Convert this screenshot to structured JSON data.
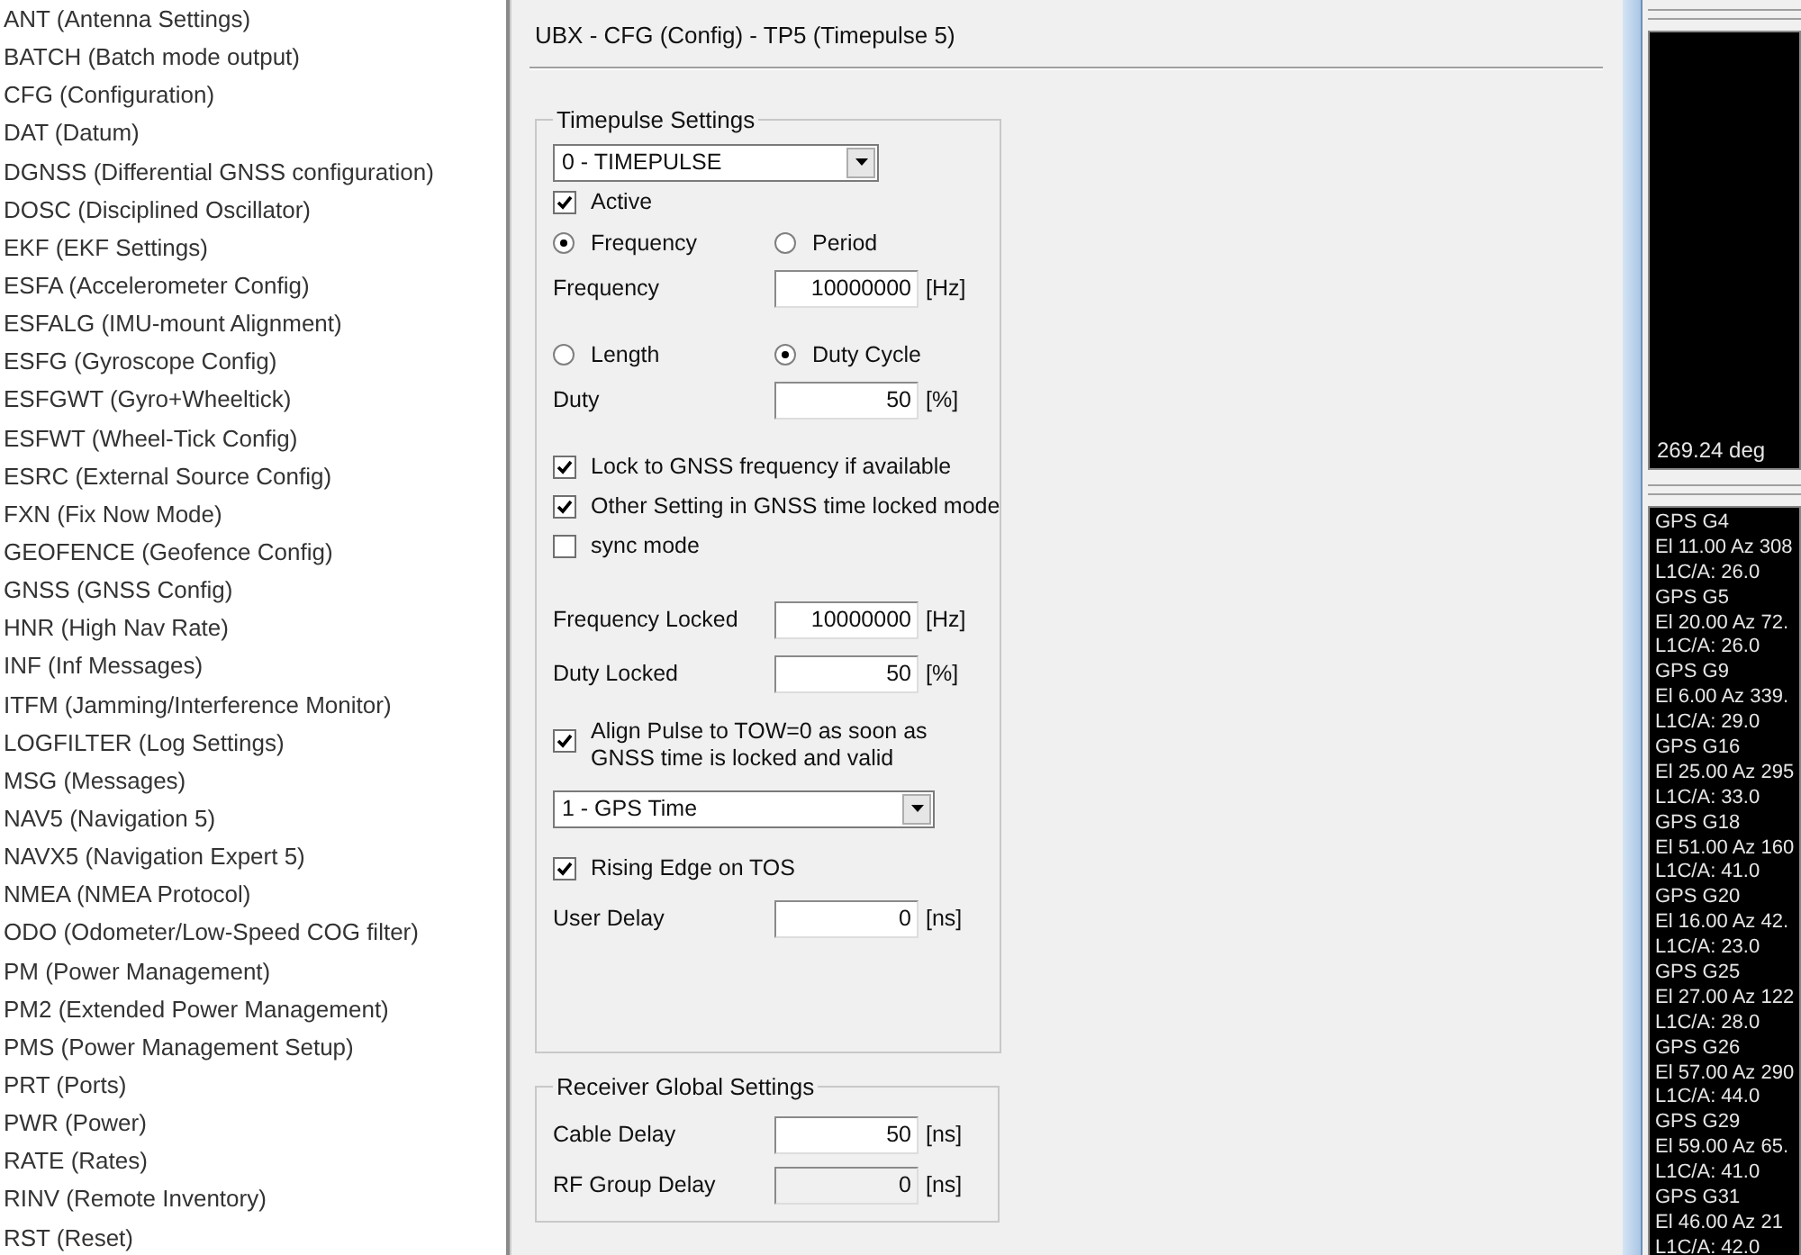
{
  "sidebar": {
    "items": [
      "ANT (Antenna Settings)",
      "BATCH (Batch mode output)",
      "CFG (Configuration)",
      "DAT (Datum)",
      "DGNSS (Differential GNSS configuration)",
      "DOSC (Disciplined Oscillator)",
      "EKF (EKF Settings)",
      "ESFA (Accelerometer Config)",
      "ESFALG (IMU-mount Alignment)",
      "ESFG (Gyroscope Config)",
      "ESFGWT (Gyro+Wheeltick)",
      "ESFWT (Wheel-Tick Config)",
      "ESRC (External Source Config)",
      "FXN (Fix Now Mode)",
      "GEOFENCE (Geofence Config)",
      "GNSS (GNSS Config)",
      "HNR (High Nav Rate)",
      "INF (Inf Messages)",
      "ITFM (Jamming/Interference Monitor)",
      "LOGFILTER (Log Settings)",
      "MSG (Messages)",
      "NAV5 (Navigation 5)",
      "NAVX5 (Navigation Expert 5)",
      "NMEA (NMEA Protocol)",
      "ODO (Odometer/Low-Speed COG filter)",
      "PM (Power Management)",
      "PM2 (Extended Power Management)",
      "PMS (Power Management Setup)",
      "PRT (Ports)",
      "PWR (Power)",
      "RATE (Rates)",
      "RINV (Remote Inventory)",
      "RST (Reset)"
    ]
  },
  "panel": {
    "title": "UBX - CFG (Config) - TP5 (Timepulse 5)",
    "groups": [
      {
        "title": "Timepulse Settings",
        "rows": [
          {
            "kind": "select",
            "value": "0 - TIMEPULSE"
          },
          {
            "kind": "checkbox",
            "label": "Active",
            "checked": true
          },
          {
            "kind": "radios",
            "options": [
              {
                "label": "Frequency",
                "selected": true
              },
              {
                "label": "Period",
                "selected": false
              }
            ]
          },
          {
            "kind": "field",
            "label": "Frequency",
            "value": "10000000",
            "unit": "[Hz]",
            "disabled": false
          },
          {
            "kind": "radios",
            "options": [
              {
                "label": "Length",
                "selected": false
              },
              {
                "label": "Duty Cycle",
                "selected": true
              }
            ]
          },
          {
            "kind": "field",
            "label": "Duty",
            "value": "50",
            "unit": "[%]",
            "disabled": false
          },
          {
            "kind": "checkbox",
            "label": "Lock to GNSS frequency if available",
            "checked": true
          },
          {
            "kind": "checkbox",
            "label": "Other Setting in GNSS time locked mode",
            "checked": true
          },
          {
            "kind": "checkbox",
            "label": "sync mode",
            "checked": false
          },
          {
            "kind": "field",
            "label": "Frequency Locked",
            "value": "10000000",
            "unit": "[Hz]",
            "disabled": false
          },
          {
            "kind": "field",
            "label": "Duty Locked",
            "value": "50",
            "unit": "[%]",
            "disabled": false
          },
          {
            "kind": "checkbox",
            "label": "Align Pulse to TOW=0 as soon as GNSS time is locked and valid",
            "checked": true
          },
          {
            "kind": "select",
            "value": "1 - GPS Time"
          },
          {
            "kind": "checkbox",
            "label": "Rising Edge on TOS",
            "checked": true
          },
          {
            "kind": "field",
            "label": "User Delay",
            "value": "0",
            "unit": "[ns]",
            "disabled": false
          }
        ]
      },
      {
        "title": "Receiver Global Settings",
        "rows": [
          {
            "kind": "field",
            "label": "Cable Delay",
            "value": "50",
            "unit": "[ns]",
            "disabled": false
          },
          {
            "kind": "field",
            "label": "RF Group Delay",
            "value": "0",
            "unit": "[ns]",
            "disabled": true
          }
        ]
      }
    ]
  },
  "side_view": {
    "heading_reading": "269.24 deg",
    "satellites": [
      {
        "name": "GPS G4",
        "position": "El 11.00 Az 308",
        "signal": "L1C/A: 26.0"
      },
      {
        "name": "GPS G5",
        "position": "El 20.00 Az 72.",
        "signal": "L1C/A: 26.0"
      },
      {
        "name": "GPS G9",
        "position": "El 6.00 Az 339.",
        "signal": "L1C/A: 29.0"
      },
      {
        "name": "GPS G16",
        "position": "El 25.00 Az 295",
        "signal": "L1C/A: 33.0"
      },
      {
        "name": "GPS G18",
        "position": "El 51.00 Az 160",
        "signal": "L1C/A: 41.0"
      },
      {
        "name": "GPS G20",
        "position": "El 16.00 Az 42.",
        "signal": "L1C/A: 23.0"
      },
      {
        "name": "GPS G25",
        "position": "El 27.00 Az 122",
        "signal": "L1C/A: 28.0"
      },
      {
        "name": "GPS G26",
        "position": "El 57.00 Az 290",
        "signal": "L1C/A: 44.0"
      },
      {
        "name": "GPS G29",
        "position": "El 59.00 Az 65.",
        "signal": "L1C/A: 41.0"
      },
      {
        "name": "GPS G31",
        "position": "El 46.00 Az 21",
        "signal": "L1C/A: 42.0"
      }
    ]
  }
}
